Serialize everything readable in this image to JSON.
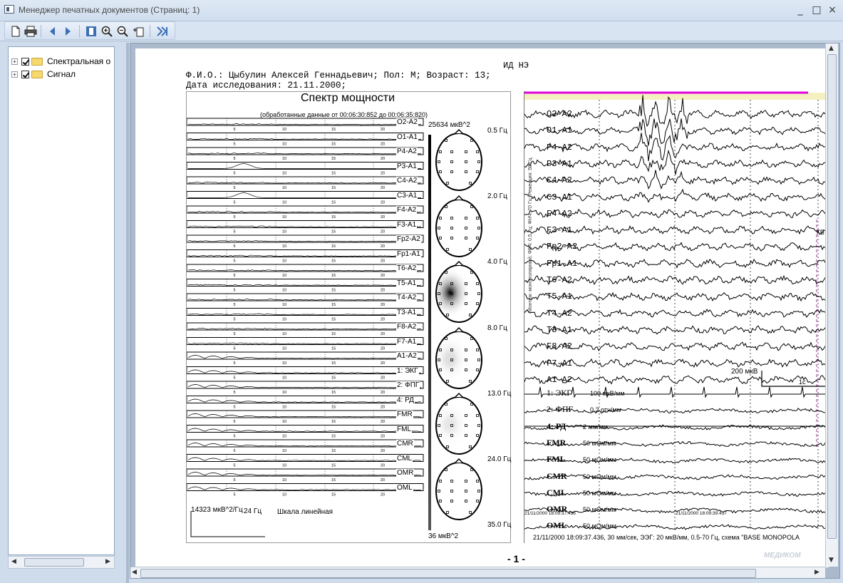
{
  "window": {
    "title": "Менеджер печатных документов (Страниц: 1)",
    "controls": [
      "_",
      "□",
      "×"
    ]
  },
  "toolbar": {
    "buttons": [
      "new-icon",
      "print-icon",
      "back-icon",
      "forward-icon",
      "page-view-icon",
      "zoom-in-icon",
      "zoom-out-icon",
      "fit-icon",
      "export-icon"
    ]
  },
  "tree": {
    "items": [
      {
        "label": "Спектральная о",
        "checked": true,
        "expander": "+"
      },
      {
        "label": "Сигнал",
        "checked": true,
        "expander": "+"
      }
    ]
  },
  "report": {
    "header_code": "ИД НЭ",
    "patient_line": "Ф.И.О.: Цыбулин Алексей Геннадьевич; Пол: М; Возраст: 13;",
    "date_line": "Дата исследования: 21.11.2000;",
    "page_number": "- 1 -",
    "logo_text": "МЕДИКОМ"
  },
  "spectrum": {
    "title": "Спектр мощности",
    "subtitle": "(обработанные данные от 00:06:30:852 до 00:06:35:820)",
    "channels": [
      "O2-A2",
      "O1-A1",
      "P4-A2",
      "P3-A1",
      "C4-A2",
      "C3-A1",
      "F4-A2",
      "F3-A1",
      "Fp2-A2",
      "Fp1-A1",
      "T6-A2",
      "T5-A1",
      "T4-A2",
      "T3-A1",
      "F8-A2",
      "F7-A1",
      "A1-A2",
      "1: ЭКГ",
      "2: ФПГ",
      "4: РД",
      "FMR",
      "FML",
      "CMR",
      "CML",
      "OMR",
      "OML"
    ],
    "axis_ticks": [
      "5",
      "10",
      "15",
      "20"
    ],
    "scale_value": "14323 мкВ^2/Гц",
    "scale_freq": "24 Гц",
    "scale_type": "Шкала линейная",
    "colorbar_max": "25634 мкВ^2",
    "colorbar_min": "36 мкВ^2",
    "map_freqs": [
      "0.5 Гц",
      "2.0 Гц",
      "4.0 Гц",
      "8.0 Гц",
      "13.0 Гц",
      "24.0 Гц",
      "35.0 Гц"
    ]
  },
  "eeg": {
    "channels": [
      "O2-A2",
      "O1-A1",
      "P4-A2",
      "P3-A1",
      "C4-A2",
      "C3-A1",
      "F4-A2",
      "F3-A1",
      "Fp2-A2",
      "Fp1-A1",
      "T6-A2",
      "T5-A1",
      "T4-A2",
      "T3-A1",
      "F8-A2",
      "F7-A1",
      "A1-A2"
    ],
    "poly": [
      {
        "label": "1: ЭКГ",
        "unit": "100 мкВ/мм"
      },
      {
        "label": "2: ФПГ",
        "unit": "0.2 отн/мм"
      },
      {
        "label": "4: РД",
        "unit": "2 мм/мм"
      },
      {
        "label": "FMR",
        "unit": "50 мОм/мм"
      },
      {
        "label": "FML",
        "unit": "50 мОм/мм"
      },
      {
        "label": "CMR",
        "unit": "50 мОм/мм"
      },
      {
        "label": "CML",
        "unit": "50 мОм/мм"
      },
      {
        "label": "OMR",
        "unit": "50 мОм/мм"
      },
      {
        "label": "OML",
        "unit": "50 мОм/мм"
      }
    ],
    "calib_amp": "200 мкВ",
    "calib_time": "1с",
    "side_text": "Монтаж: монополярный; ФВЧ: 0.5 Гц; ФНЧ: 70 Гц; Режекция: 50 Гц",
    "marker_text": "ГВ",
    "timestamp_a": "21/11/2000 18:09:37.436",
    "timestamp_b": "21/11/2000 18:09:39.437",
    "footer": "21/11/2000 18:09:37.436,   30 мм/сек,   ЭЭГ: 20 мкВ/мм, 0.5-70 Гц,   схема \"BASE MONOPOLA"
  }
}
